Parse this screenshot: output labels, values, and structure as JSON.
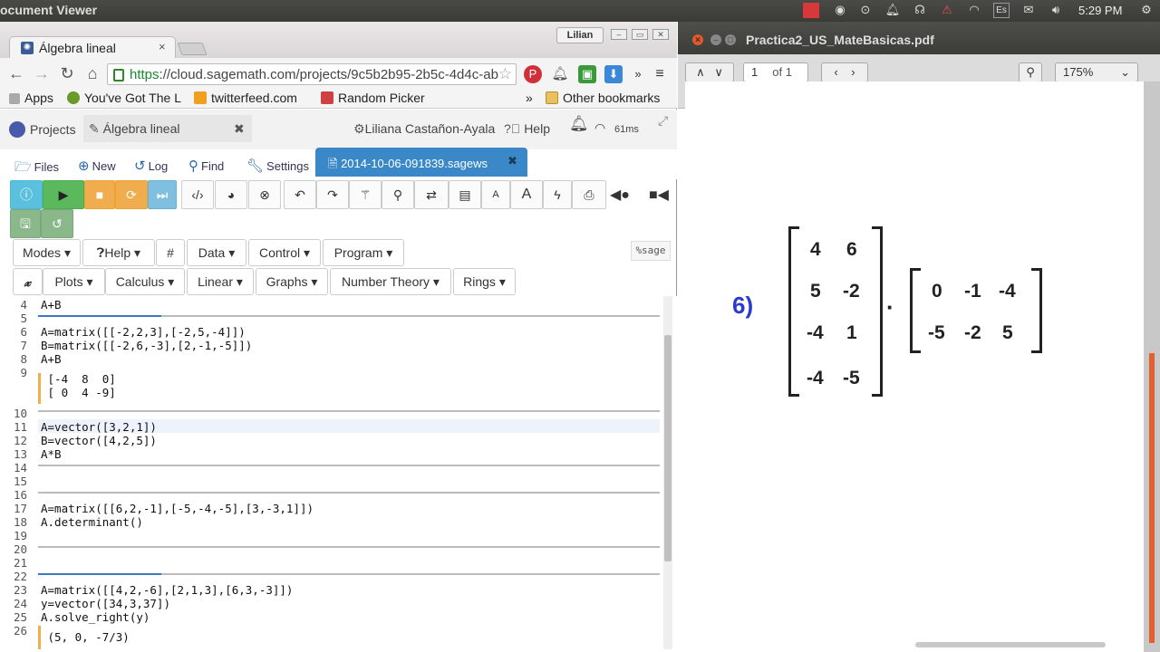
{
  "top_panel": {
    "title": "ocument Viewer",
    "clock": "5:29 PM",
    "keyboard": "Es"
  },
  "browser": {
    "tab_label": "Álgebra lineal",
    "tab_close": "×",
    "username": "Lilian",
    "url_https": "https",
    "url_rest": "://cloud.sagemath.com/projects/9c5b2b95-2b5c-4d4c-ab",
    "bookmarks": [
      {
        "label": "Apps",
        "color": "#5a8a3a"
      },
      {
        "label": "You've Got The L",
        "color": "#5a8a3a"
      },
      {
        "label": "twitterfeed.com",
        "color": "#f0a020"
      },
      {
        "label": "Random Picker",
        "color": "#d04040"
      }
    ],
    "bookmarks_more": "»",
    "other_bookmarks": "Other bookmarks"
  },
  "sage": {
    "projects": "Projects",
    "project_name": "Álgebra lineal",
    "user": "Liliana Castañon-Ayala",
    "help": "Help",
    "ping": "61ms",
    "file_tabs": [
      "Files",
      "New",
      "Log",
      "Find",
      "Settings"
    ],
    "open_file": "2014-10-06-091839.sagews",
    "menus_row1": [
      "Modes ▾",
      "Help ▾",
      "#",
      "Data ▾",
      "Control ▾",
      "Program ▾"
    ],
    "menus_row2": [
      "𝔁",
      "Plots ▾",
      "Calculus ▾",
      "Linear ▾",
      "Graphs ▾",
      "Number Theory ▾",
      "Rings ▾"
    ],
    "mode_label": "%sage"
  },
  "editor": {
    "lines": [
      {
        "n": "4",
        "code": "A+B"
      },
      {
        "n": "5",
        "code": ""
      },
      {
        "n": "6",
        "code": "A=matrix([[-2,2,3],[-2,5,-4]])"
      },
      {
        "n": "7",
        "code": "B=matrix([[-2,6,-3],[2,-1,-5]])"
      },
      {
        "n": "8",
        "code": "A+B"
      },
      {
        "n": "9",
        "code": " [-4  8  0]"
      },
      {
        "n": "",
        "code": " [ 0  4 -9]"
      },
      {
        "n": "10",
        "code": ""
      },
      {
        "n": "11",
        "code": "A=vector([3,2,1])"
      },
      {
        "n": "12",
        "code": "B=vector([4,2,5])"
      },
      {
        "n": "13",
        "code": "A*B"
      },
      {
        "n": "14",
        "code": ""
      },
      {
        "n": "15",
        "code": ""
      },
      {
        "n": "16",
        "code": ""
      },
      {
        "n": "17",
        "code": "A=matrix([[6,2,-1],[-5,-4,-5],[3,-3,1]])"
      },
      {
        "n": "18",
        "code": "A.determinant()"
      },
      {
        "n": "19",
        "code": ""
      },
      {
        "n": "20",
        "code": ""
      },
      {
        "n": "21",
        "code": ""
      },
      {
        "n": "22",
        "code": ""
      },
      {
        "n": "23",
        "code": "A=matrix([[4,2,-6],[2,1,3],[6,3,-3]])"
      },
      {
        "n": "24",
        "code": "y=vector([34,3,37])"
      },
      {
        "n": "25",
        "code": "A.solve_right(y)"
      },
      {
        "n": "26",
        "code": " (5, 0, -7/3)"
      }
    ]
  },
  "pdf": {
    "title": "Practica2_US_MateBasicas.pdf",
    "page": "1",
    "of": "of 1",
    "zoom": "175%",
    "problem": "6)",
    "matrix_a": [
      [
        "4",
        "6"
      ],
      [
        "5",
        "-2"
      ],
      [
        "-4",
        "1"
      ],
      [
        "-4",
        "-5"
      ]
    ],
    "dot": "·",
    "matrix_b": [
      [
        "0",
        "-1",
        "-4"
      ],
      [
        "-5",
        "-2",
        "5"
      ]
    ]
  }
}
